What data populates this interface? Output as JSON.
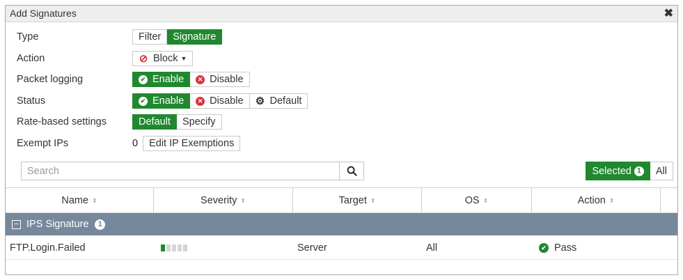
{
  "dialog": {
    "title": "Add Signatures"
  },
  "form": {
    "type": {
      "label": "Type",
      "options": [
        "Filter",
        "Signature"
      ],
      "selected": "Signature"
    },
    "action": {
      "label": "Action",
      "value": "Block"
    },
    "packet_logging": {
      "label": "Packet logging",
      "enable": "Enable",
      "disable": "Disable",
      "selected": "Enable"
    },
    "status": {
      "label": "Status",
      "enable": "Enable",
      "disable": "Disable",
      "default": "Default",
      "selected": "Enable"
    },
    "rate_based": {
      "label": "Rate-based settings",
      "options": [
        "Default",
        "Specify"
      ],
      "selected": "Default"
    },
    "exempt_ips": {
      "label": "Exempt IPs",
      "count": "0",
      "button": "Edit IP Exemptions"
    }
  },
  "search": {
    "placeholder": "Search"
  },
  "filter_toggle": {
    "selected_label": "Selected",
    "selected_count": "1",
    "all_label": "All"
  },
  "table": {
    "columns": [
      "Name",
      "Severity",
      "Target",
      "OS",
      "Action"
    ],
    "group": {
      "label": "IPS Signature",
      "count": "1"
    },
    "rows": [
      {
        "name": "FTP.Login.Failed",
        "severity_level": 1,
        "severity_max": 5,
        "target": "Server",
        "os": "All",
        "action": "Pass"
      }
    ]
  },
  "colors": {
    "accent": "#20882f",
    "group_bg": "#76889b",
    "danger": "#d8343f"
  }
}
